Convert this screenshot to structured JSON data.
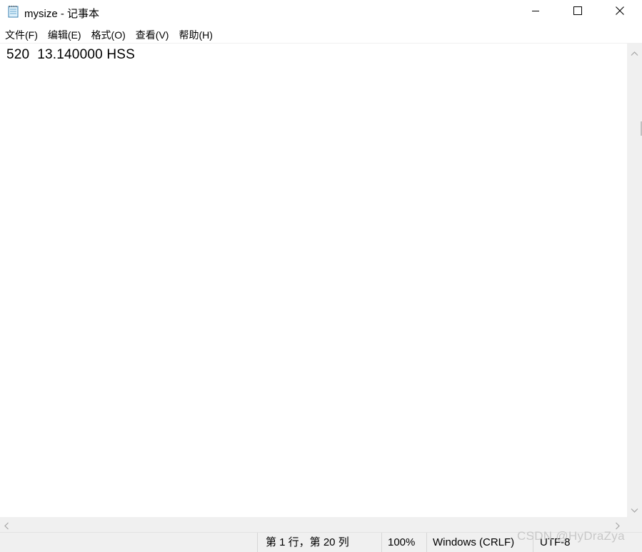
{
  "window": {
    "title": "mysize - 记事本",
    "icon": "notepad-icon",
    "controls": {
      "minimize": "minimize-icon",
      "maximize": "maximize-icon",
      "close": "close-icon"
    }
  },
  "menu": [
    {
      "label": "文件(F)"
    },
    {
      "label": "编辑(E)"
    },
    {
      "label": "格式(O)"
    },
    {
      "label": "查看(V)"
    },
    {
      "label": "帮助(H)"
    }
  ],
  "editor": {
    "content": "520  13.140000 HSS"
  },
  "status": {
    "position": "第 1 行，第 20 列",
    "zoom": "100%",
    "line_ending": "Windows (CRLF)",
    "encoding": "UTF-8"
  },
  "watermark": "CSDN @HyDraZya",
  "colors": {
    "chrome": "#f0f0f0",
    "editor_bg": "#ffffff",
    "text": "#000000"
  }
}
